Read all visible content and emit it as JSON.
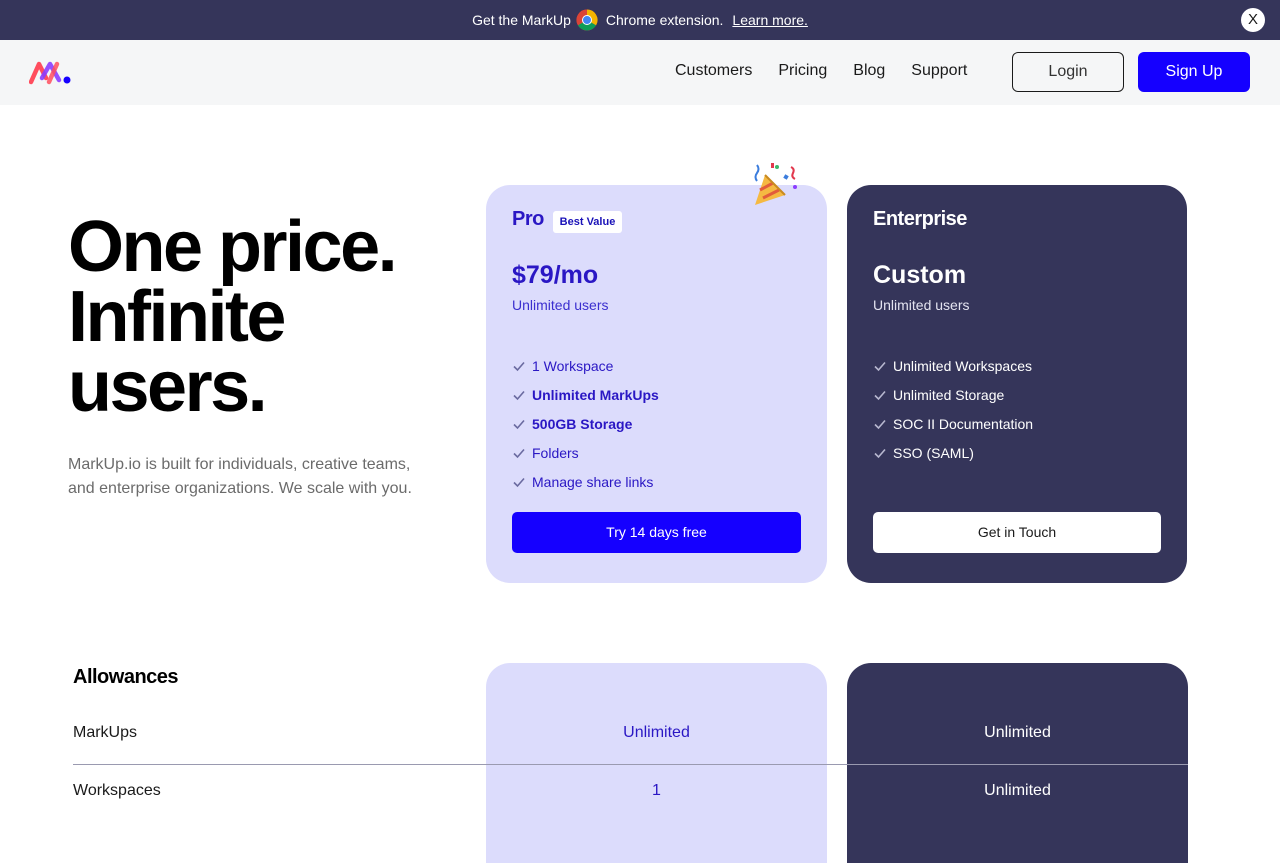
{
  "announcement": {
    "text_before": "Get the MarkUp",
    "text_after": "Chrome extension.",
    "link": "Learn more.",
    "close_label": "X"
  },
  "header": {
    "nav": [
      "Customers",
      "Pricing",
      "Blog",
      "Support"
    ],
    "login_label": "Login",
    "signup_label": "Sign Up"
  },
  "hero": {
    "title_lines": [
      "One price.",
      "Infinite",
      "users."
    ],
    "subtitle": "MarkUp.io is built for individuals, creative teams, and enterprise organizations. We scale with you."
  },
  "plans": {
    "pro": {
      "name": "Pro",
      "badge": "Best Value",
      "price": "$79/mo",
      "users": "Unlimited users",
      "features": [
        "1 Workspace",
        "Unlimited MarkUps",
        "500GB Storage",
        "Folders",
        "Manage share links"
      ],
      "cta": "Try 14 days free"
    },
    "enterprise": {
      "name": "Enterprise",
      "price": "Custom",
      "users": "Unlimited users",
      "features": [
        "Unlimited Workspaces",
        "Unlimited Storage",
        "SOC II Documentation",
        "SSO (SAML)"
      ],
      "cta": "Get in Touch"
    }
  },
  "allowances": {
    "title": "Allowances",
    "rows": [
      {
        "label": "MarkUps",
        "pro": "Unlimited",
        "enterprise": "Unlimited"
      },
      {
        "label": "Workspaces",
        "pro": "1",
        "enterprise": "Unlimited"
      }
    ]
  },
  "colors": {
    "brand_blue": "#1500ff",
    "navy": "#35355a",
    "lavender": "#dcdcfc",
    "pro_text": "#2a17c4"
  },
  "icons": [
    "chrome-icon",
    "markup-logo",
    "party-popper-icon",
    "check-icon",
    "close-icon"
  ]
}
